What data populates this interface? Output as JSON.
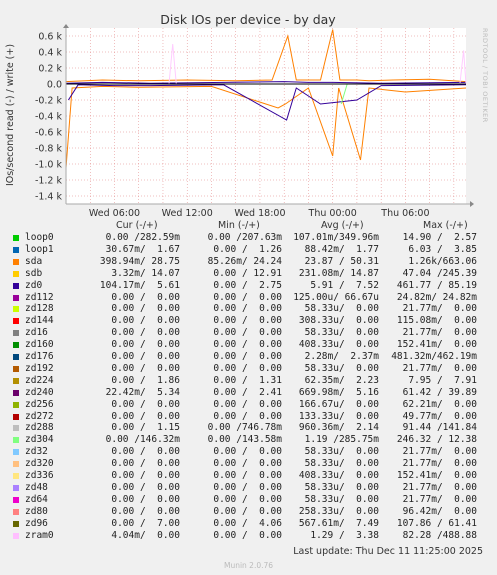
{
  "chart_data": {
    "type": "line",
    "title": "Disk IOs per device - by day",
    "ylabel": "IOs/second read (-) / write (+)",
    "ylim": [
      -1.5,
      0.7
    ],
    "y_ticks": [
      "0.6 k",
      "0.4 k",
      "0.2 k",
      "0.0",
      "-0.2 k",
      "-0.4 k",
      "-0.6 k",
      "-0.8 k",
      "-1.0 k",
      "-1.2 k",
      "-1.4 k"
    ],
    "y_tick_values": [
      0.6,
      0.4,
      0.2,
      0,
      -0.2,
      -0.4,
      -0.6,
      -0.8,
      -1.0,
      -1.2,
      -1.4
    ],
    "x_ticks": [
      "Wed 06:00",
      "Wed 12:00",
      "Wed 18:00",
      "Thu 00:00",
      "Thu 06:00"
    ],
    "x_tick_hours": [
      6,
      12,
      18,
      24,
      30
    ],
    "x_range_hours": [
      2,
      35
    ],
    "grid": true,
    "series": [
      {
        "name": "sda",
        "color": "#ff8000",
        "write": [
          [
            2,
            0.03
          ],
          [
            5,
            0.05
          ],
          [
            8,
            0.04
          ],
          [
            12,
            0.05
          ],
          [
            16,
            0.04
          ],
          [
            19,
            0.05
          ],
          [
            20.3,
            0.6
          ],
          [
            21,
            0.05
          ],
          [
            23,
            0.05
          ],
          [
            24,
            0.68
          ],
          [
            24.6,
            0.05
          ],
          [
            26,
            0.05
          ],
          [
            27,
            0.04
          ],
          [
            29,
            0.05
          ],
          [
            32,
            0.06
          ],
          [
            35,
            0.03
          ]
        ],
        "read": [
          [
            2,
            -1.05
          ],
          [
            2.5,
            -0.05
          ],
          [
            5,
            -0.03
          ],
          [
            8,
            -0.04
          ],
          [
            14,
            -0.03
          ],
          [
            19.5,
            -0.3
          ],
          [
            20.1,
            -0.25
          ],
          [
            22,
            -0.05
          ],
          [
            24,
            -0.9
          ],
          [
            24.5,
            -0.05
          ],
          [
            26.3,
            -0.95
          ],
          [
            27,
            -0.05
          ],
          [
            30,
            -0.1
          ],
          [
            35,
            -0.05
          ]
        ]
      },
      {
        "name": "zd0",
        "color": "#330099",
        "write": [
          [
            2,
            0.01
          ],
          [
            5,
            0.02
          ],
          [
            9,
            0.01
          ],
          [
            15,
            0.02
          ],
          [
            20,
            0.03
          ],
          [
            22,
            0.02
          ],
          [
            24,
            0.02
          ],
          [
            28,
            0.01
          ],
          [
            35,
            0.02
          ]
        ],
        "read": [
          [
            2.2,
            -0.2
          ],
          [
            3,
            -0.01
          ],
          [
            6,
            -0.02
          ],
          [
            9,
            -0.02
          ],
          [
            15,
            -0.01
          ],
          [
            20.2,
            -0.45
          ],
          [
            21,
            -0.05
          ],
          [
            23,
            -0.25
          ],
          [
            26,
            -0.2
          ],
          [
            28,
            -0.02
          ],
          [
            35,
            -0.01
          ]
        ]
      },
      {
        "name": "zd304",
        "color": "#80ff80",
        "write": [
          [
            2,
            0.0
          ],
          [
            35,
            0.0
          ]
        ],
        "read": [
          [
            24.7,
            -0.25
          ],
          [
            25.2,
            0.0
          ]
        ]
      },
      {
        "name": "zram0",
        "color": "#ffccff",
        "write": [
          [
            10.5,
            0.0
          ],
          [
            10.8,
            0.5
          ],
          [
            11.1,
            0.0
          ],
          [
            34.5,
            0.0
          ],
          [
            34.8,
            0.42
          ],
          [
            35,
            0.0
          ]
        ],
        "read": [
          [
            2,
            0.0
          ],
          [
            35,
            0.0
          ]
        ]
      }
    ]
  },
  "legend": {
    "col_cur": "Cur (-/+)",
    "col_min": "Min (-/+)",
    "col_avg": "Avg (-/+)",
    "col_max": "Max (-/+)",
    "rows": [
      {
        "name": "loop0",
        "color": "#00cc00",
        "cur": "0.00 /282.59m",
        "min": "0.00 /207.63m",
        "avg": "107.01m/349.96m",
        "max": "14.90 /  2.57"
      },
      {
        "name": "loop1",
        "color": "#0066b3",
        "cur": "30.67m/  1.67",
        "min": "0.00 /  1.26",
        "avg": "88.42m/  1.77",
        "max": "6.03 /  3.85"
      },
      {
        "name": "sda",
        "color": "#ff8000",
        "cur": "398.94m/ 28.75",
        "min": "85.26m/ 24.24",
        "avg": "23.87 / 50.31",
        "max": "1.26k/663.06"
      },
      {
        "name": "sdb",
        "color": "#ffcc00",
        "cur": "3.32m/ 14.07",
        "min": "0.00 / 12.91",
        "avg": "231.08m/ 14.87",
        "max": "47.04 /245.39"
      },
      {
        "name": "zd0",
        "color": "#330099",
        "cur": "104.17m/  5.61",
        "min": "0.00 /  2.75",
        "avg": "5.91 /  7.52",
        "max": "461.77 / 85.19"
      },
      {
        "name": "zd112",
        "color": "#990099",
        "cur": "0.00 /  0.00",
        "min": "0.00 /  0.00",
        "avg": "125.00u/ 66.67u",
        "max": "24.82m/ 24.82m"
      },
      {
        "name": "zd128",
        "color": "#ccff00",
        "cur": "0.00 /  0.00",
        "min": "0.00 /  0.00",
        "avg": "58.33u/  0.00",
        "max": "21.77m/  0.00"
      },
      {
        "name": "zd144",
        "color": "#ff0000",
        "cur": "0.00 /  0.00",
        "min": "0.00 /  0.00",
        "avg": "308.33u/  0.00",
        "max": "115.08m/  0.00"
      },
      {
        "name": "zd16",
        "color": "#808080",
        "cur": "0.00 /  0.00",
        "min": "0.00 /  0.00",
        "avg": "58.33u/  0.00",
        "max": "21.77m/  0.00"
      },
      {
        "name": "zd160",
        "color": "#008f00",
        "cur": "0.00 /  0.00",
        "min": "0.00 /  0.00",
        "avg": "408.33u/  0.00",
        "max": "152.41m/  0.00"
      },
      {
        "name": "zd176",
        "color": "#00487d",
        "cur": "0.00 /  0.00",
        "min": "0.00 /  0.00",
        "avg": "2.28m/  2.37m",
        "max": "481.32m/462.19m"
      },
      {
        "name": "zd192",
        "color": "#b35a00",
        "cur": "0.00 /  0.00",
        "min": "0.00 /  0.00",
        "avg": "58.33u/  0.00",
        "max": "21.77m/  0.00"
      },
      {
        "name": "zd224",
        "color": "#b38f00",
        "cur": "0.00 /  1.86",
        "min": "0.00 /  1.31",
        "avg": "62.35m/  2.23",
        "max": "7.95 /  7.91"
      },
      {
        "name": "zd240",
        "color": "#6b006b",
        "cur": "22.42m/  5.34",
        "min": "0.00 /  2.41",
        "avg": "669.98m/  5.16",
        "max": "61.42 / 39.89"
      },
      {
        "name": "zd256",
        "color": "#8fb300",
        "cur": "0.00 /  0.00",
        "min": "0.00 /  0.00",
        "avg": "166.67u/  0.00",
        "max": "62.21m/  0.00"
      },
      {
        "name": "zd272",
        "color": "#b30000",
        "cur": "0.00 /  0.00",
        "min": "0.00 /  0.00",
        "avg": "133.33u/  0.00",
        "max": "49.77m/  0.00"
      },
      {
        "name": "zd288",
        "color": "#bebebe",
        "cur": "0.00 /  1.15",
        "min": "0.00 /746.78m",
        "avg": "960.36m/  2.14",
        "max": "91.44 /141.84"
      },
      {
        "name": "zd304",
        "color": "#80ff80",
        "cur": "0.00 /146.32m",
        "min": "0.00 /143.58m",
        "avg": "1.19 /285.75m",
        "max": "246.32 / 12.38"
      },
      {
        "name": "zd32",
        "color": "#80c9ff",
        "cur": "0.00 /  0.00",
        "min": "0.00 /  0.00",
        "avg": "58.33u/  0.00",
        "max": "21.77m/  0.00"
      },
      {
        "name": "zd320",
        "color": "#ffc080",
        "cur": "0.00 /  0.00",
        "min": "0.00 /  0.00",
        "avg": "58.33u/  0.00",
        "max": "21.77m/  0.00"
      },
      {
        "name": "zd336",
        "color": "#ffe680",
        "cur": "0.00 /  0.00",
        "min": "0.00 /  0.00",
        "avg": "408.33u/  0.00",
        "max": "152.41m/  0.00"
      },
      {
        "name": "zd48",
        "color": "#aa80ff",
        "cur": "0.00 /  0.00",
        "min": "0.00 /  0.00",
        "avg": "58.33u/  0.00",
        "max": "21.77m/  0.00"
      },
      {
        "name": "zd64",
        "color": "#ee00cc",
        "cur": "0.00 /  0.00",
        "min": "0.00 /  0.00",
        "avg": "58.33u/  0.00",
        "max": "21.77m/  0.00"
      },
      {
        "name": "zd80",
        "color": "#ff8080",
        "cur": "0.00 /  0.00",
        "min": "0.00 /  0.00",
        "avg": "258.33u/  0.00",
        "max": "96.42m/  0.00"
      },
      {
        "name": "zd96",
        "color": "#666600",
        "cur": "0.00 /  7.00",
        "min": "0.00 /  4.06",
        "avg": "567.61m/  7.49",
        "max": "107.86 / 61.41"
      },
      {
        "name": "zram0",
        "color": "#ffbfff",
        "cur": "4.04m/  0.00",
        "min": "0.00 /  0.00",
        "avg": "1.29 /  3.38",
        "max": "82.28 /488.88"
      }
    ]
  },
  "last_update": "Last update: Thu Dec 11 11:25:00 2025",
  "munin_version": "Munin 2.0.76",
  "watermark": "RRDTOOL / TOBI OETIKER"
}
